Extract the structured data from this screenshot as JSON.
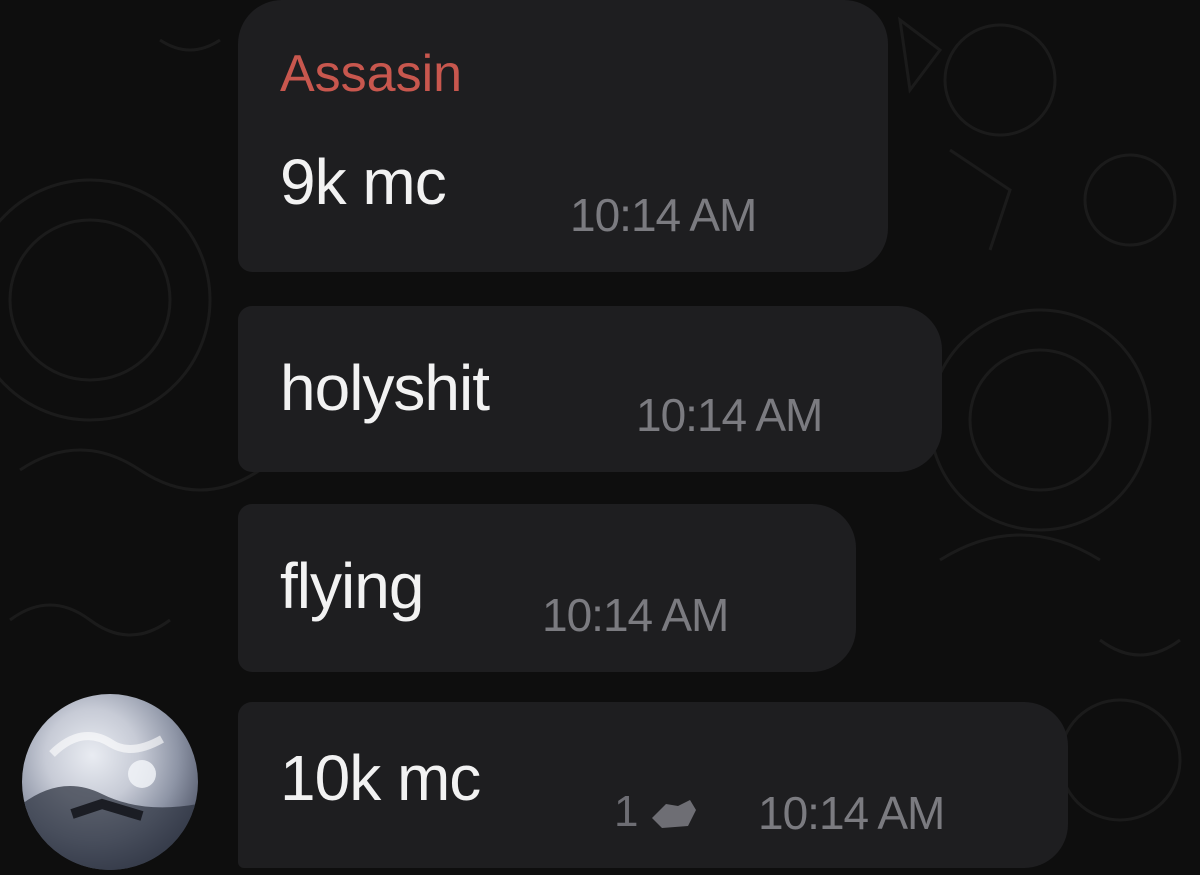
{
  "messages": [
    {
      "sender": "Assasin",
      "text": "9k mc",
      "time": "10:14 AM"
    },
    {
      "text": "holyshit",
      "time": "10:14 AM"
    },
    {
      "text": "flying",
      "time": "10:14 AM"
    },
    {
      "text": "10k mc",
      "time": "10:14 AM",
      "reaction_count": "1",
      "reaction_icon": "hand-icon"
    }
  ],
  "colors": {
    "background": "#0e0e0e",
    "bubble": "#1e1e20",
    "sender_name": "#c8574e",
    "message_text": "#f2f2f2",
    "timestamp": "#7b7b80"
  }
}
